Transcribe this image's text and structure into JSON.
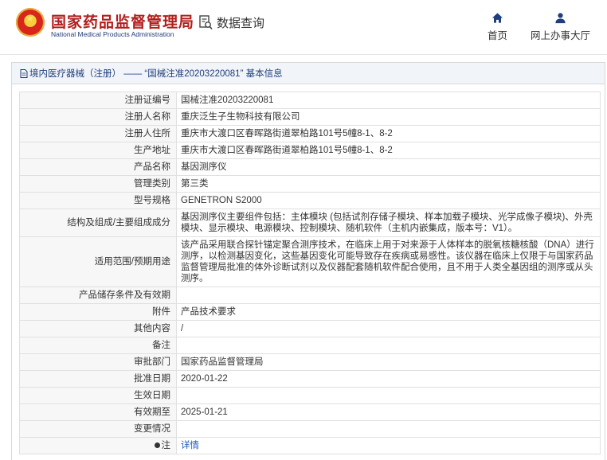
{
  "header": {
    "logo_icon": "national-emblem",
    "brand_cn": "国家药品监督管理局",
    "brand_en": "National Medical Products Administration",
    "query_icon": "document-search-icon",
    "query_label": "数据查询",
    "nav": [
      {
        "icon": "home-icon",
        "label": "首页"
      },
      {
        "icon": "user-icon",
        "label": "网上办事大厅"
      }
    ]
  },
  "panel": {
    "icon": "document-icon",
    "title": "境内医疗器械（注册） —— “国械注准20203220081” 基本信息"
  },
  "rows": [
    {
      "label": "注册证编号",
      "value": "国械注准20203220081"
    },
    {
      "label": "注册人名称",
      "value": "重庆泛生子生物科技有限公司"
    },
    {
      "label": "注册人住所",
      "value": "重庆市大渡口区春晖路街道翠柏路101号5幢8-1、8-2"
    },
    {
      "label": "生产地址",
      "value": "重庆市大渡口区春晖路街道翠柏路101号5幢8-1、8-2"
    },
    {
      "label": "产品名称",
      "value": "基因测序仪"
    },
    {
      "label": "管理类别",
      "value": "第三类"
    },
    {
      "label": "型号规格",
      "value": "GENETRON S2000"
    },
    {
      "label": "结构及组成/主要组成成分",
      "value": "基因测序仪主要组件包括：主体模块 (包括试剂存储子模块、样本加载子模块、光学成像子模块)、外壳模块、显示模块、电源模块、控制模块、随机软件（主机内嵌集成，版本号：V1）。"
    },
    {
      "label": "适用范围/预期用途",
      "value": "该产品采用联合探针锚定聚合测序技术，在临床上用于对来源于人体样本的脱氧核糖核酸（DNA）进行测序，以检测基因变化，这些基因变化可能导致存在疾病或易感性。该仪器在临床上仅限于与国家药品监督管理局批准的体外诊断试剂以及仪器配套随机软件配合使用，且不用于人类全基因组的测序或从头测序。"
    },
    {
      "label": "产品储存条件及有效期",
      "value": ""
    },
    {
      "label": "附件",
      "value": "产品技术要求"
    },
    {
      "label": "其他内容",
      "value": "/"
    },
    {
      "label": "备注",
      "value": ""
    },
    {
      "label": "审批部门",
      "value": "国家药品监督管理局"
    },
    {
      "label": "批准日期",
      "value": "2020-01-22"
    },
    {
      "label": "生效日期",
      "value": ""
    },
    {
      "label": "有效期至",
      "value": "2025-01-21"
    },
    {
      "label": "变更情况",
      "value": ""
    }
  ],
  "note_row": {
    "label": "注",
    "icon": "info-dot-icon",
    "link": "详情"
  }
}
